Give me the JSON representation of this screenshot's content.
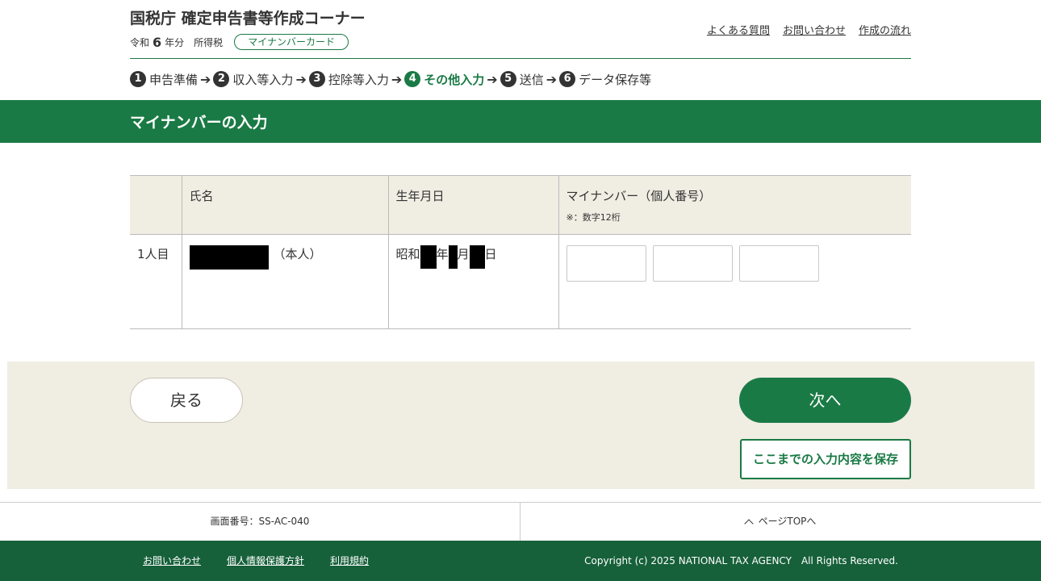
{
  "header": {
    "title": "国税庁 確定申告書等作成コーナー",
    "era": "令和",
    "year": "6",
    "year_suffix": "年分",
    "tax_type": "所得税",
    "mynumber_badge": "マイナンバーカード",
    "links": [
      "よくある質問",
      "お問い合わせ",
      "作成の流れ"
    ]
  },
  "steps": [
    {
      "num": "1",
      "label": "申告準備"
    },
    {
      "num": "2",
      "label": "収入等入力"
    },
    {
      "num": "3",
      "label": "控除等入力"
    },
    {
      "num": "4",
      "label": "その他入力",
      "active": true
    },
    {
      "num": "5",
      "label": "送信"
    },
    {
      "num": "6",
      "label": "データ保存等"
    }
  ],
  "step_arrow": "➔",
  "page": {
    "title": "マイナンバーの入力"
  },
  "table": {
    "headers": {
      "name": "氏名",
      "birth": "生年月日",
      "mynumber": "マイナンバー（個人番号）",
      "mynumber_note": "※：数字12桁"
    },
    "rows": [
      {
        "index": "1人目",
        "name_suffix": "（本人）",
        "birth_era": "昭和",
        "birth_year_unit": "年",
        "birth_month_unit": "月",
        "birth_day_unit": "日",
        "mynumber_parts": [
          "",
          "",
          ""
        ]
      }
    ]
  },
  "nav": {
    "back": "戻る",
    "next": "次へ",
    "save": "ここまでの入力内容を保存"
  },
  "footer": {
    "screen_id": "画面番号：SS-AC-040",
    "page_top": "ページTOPへ",
    "links": [
      "お問い合わせ",
      "個人情報保護方針",
      "利用規約"
    ],
    "copyright": "Copyright (c) 2025 NATIONAL TAX AGENCY　All Rights Reserved."
  },
  "colors": {
    "brand_green": "#1a7a45",
    "footer_green": "#16603a",
    "beige": "#f0ede3"
  }
}
